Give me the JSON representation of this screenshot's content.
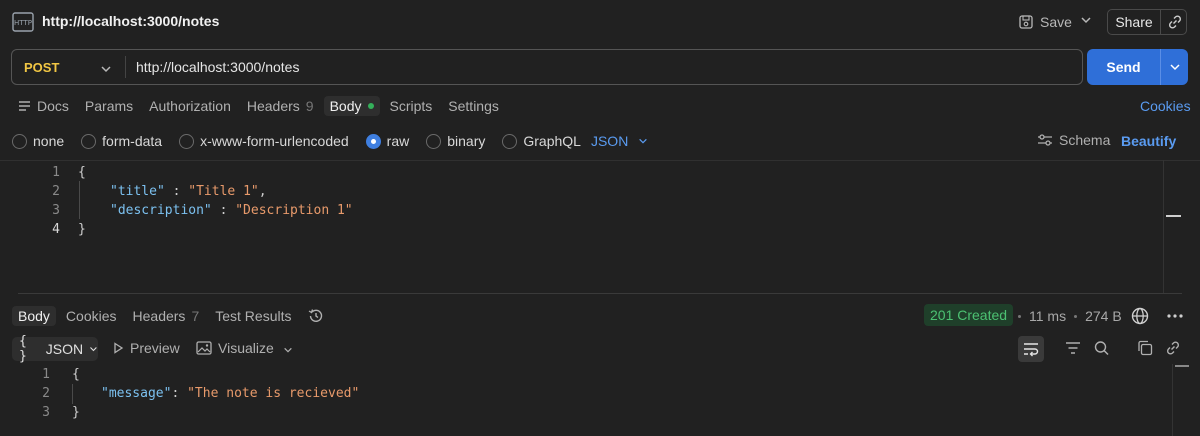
{
  "request": {
    "title": "http://localhost:3000/notes",
    "save_label": "Save",
    "share_label": "Share",
    "method": "POST",
    "url": "http://localhost:3000/notes",
    "send_label": "Send"
  },
  "request_tabs": [
    {
      "label": "Docs"
    },
    {
      "label": "Params"
    },
    {
      "label": "Authorization"
    },
    {
      "label": "Headers",
      "count": "9"
    },
    {
      "label": "Body",
      "active": true
    },
    {
      "label": "Scripts"
    },
    {
      "label": "Settings"
    }
  ],
  "cookies_label": "Cookies",
  "body_types": [
    {
      "label": "none"
    },
    {
      "label": "form-data"
    },
    {
      "label": "x-www-form-urlencoded"
    },
    {
      "label": "raw",
      "selected": true
    },
    {
      "label": "binary"
    },
    {
      "label": "GraphQL"
    }
  ],
  "body_format": "JSON",
  "schema_label": "Schema",
  "beautify_label": "Beautify",
  "request_body": {
    "lines": [
      {
        "n": "1",
        "open": "{"
      },
      {
        "n": "2",
        "key": "\"title\"",
        "sep": " : ",
        "value": "\"Title 1\"",
        "tail": ","
      },
      {
        "n": "3",
        "key": "\"description\"",
        "sep": " : ",
        "value": "\"Description 1\"",
        "tail": ""
      },
      {
        "n": "4",
        "open": "}"
      }
    ]
  },
  "response_tabs": [
    {
      "label": "Body",
      "active": true
    },
    {
      "label": "Cookies"
    },
    {
      "label": "Headers",
      "count": "7"
    },
    {
      "label": "Test Results"
    }
  ],
  "response": {
    "status": "201 Created",
    "time": "11 ms",
    "size": "274 B",
    "format": "JSON",
    "preview_label": "Preview",
    "visualize_label": "Visualize",
    "lines": [
      {
        "n": "1",
        "open": "{"
      },
      {
        "n": "2",
        "key": "\"message\"",
        "sep": ": ",
        "value": "\"The note is recieved\"",
        "tail": ""
      },
      {
        "n": "3",
        "open": "}"
      }
    ]
  },
  "colors": {
    "accent": "#2f6fd8",
    "method": "#f2c744",
    "status_ok": "#4cc172",
    "link": "#5a9bf0"
  }
}
